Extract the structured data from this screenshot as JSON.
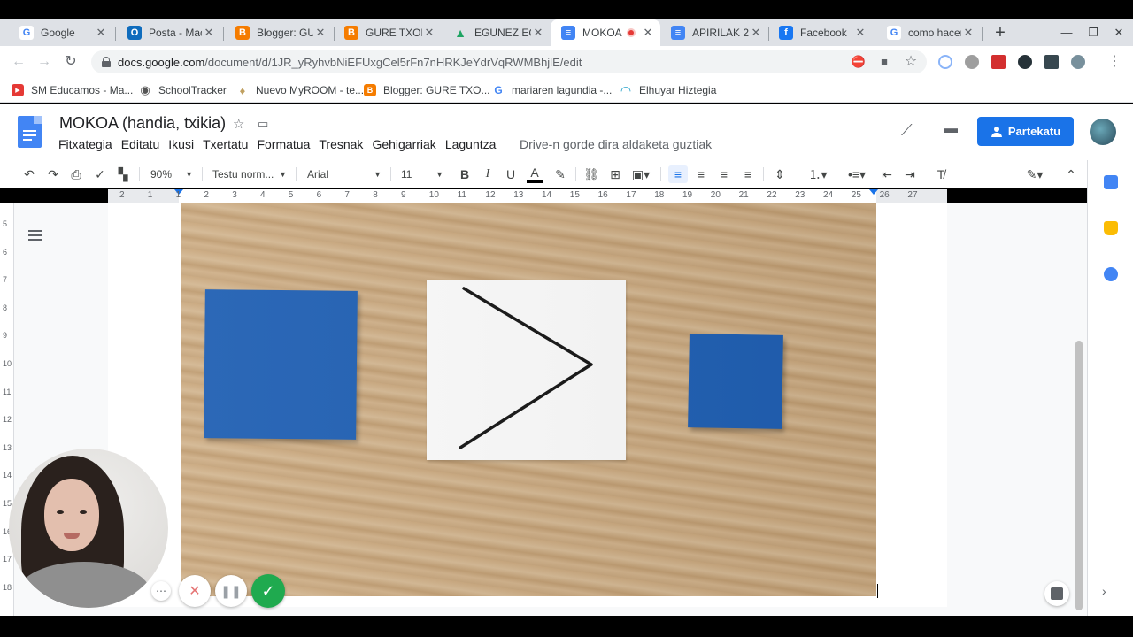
{
  "tabs": [
    {
      "title": "Google",
      "icon": "G",
      "color": "#4285f4"
    },
    {
      "title": "Posta - Mac",
      "icon": "O",
      "color": "#0f6cbd"
    },
    {
      "title": "Blogger: GU",
      "icon": "B",
      "color": "#f57c00"
    },
    {
      "title": "GURE TXOK",
      "icon": "B",
      "color": "#f57c00"
    },
    {
      "title": "EGUNEZ EG",
      "icon": "▲",
      "color": "#1fa463"
    },
    {
      "title": "MOKOA",
      "icon": "≡",
      "color": "#4285f4"
    },
    {
      "title": "APIRILAK 2",
      "icon": "≡",
      "color": "#4285f4"
    },
    {
      "title": "Facebook",
      "icon": "f",
      "color": "#1877f2"
    },
    {
      "title": "como hacer",
      "icon": "G",
      "color": "#4285f4"
    }
  ],
  "active_tab": 5,
  "close_glyph": "✕",
  "newtab_glyph": "+",
  "window": {
    "minimize": "—",
    "restore": "❐",
    "close": "✕"
  },
  "nav": {
    "back": "←",
    "forward": "→",
    "reload": "↻"
  },
  "url": {
    "host": "docs.google.com",
    "path": "/document/d/1JR_yRyhvbNiEFUxgCel5rFn7nHRKJeYdrVqRWMBhjlE/edit"
  },
  "bookmarks": [
    {
      "label": "SM Educamos - Ma...",
      "icon": "▶",
      "color": "#e53935"
    },
    {
      "label": "SchoolTracker",
      "icon": "◉",
      "color": "#555555"
    },
    {
      "label": "Nuevo MyROOM - te...",
      "icon": "♦",
      "color": "#c0a060"
    },
    {
      "label": "Blogger: GURE TXO...",
      "icon": "B",
      "color": "#f57c00"
    },
    {
      "label": "mariaren lagundia -...",
      "icon": "G",
      "color": "#4285f4"
    },
    {
      "label": "Elhuyar Hiztegia",
      "icon": "◠",
      "color": "#1fa0c8"
    }
  ],
  "document": {
    "title": "MOKOA (handia, txikia)",
    "saved_status": "Drive-n gorde dira aldaketa guztiak",
    "share_label": "Partekatu"
  },
  "menus": [
    "Fitxategia",
    "Editatu",
    "Ikusi",
    "Txertatu",
    "Formatua",
    "Tresnak",
    "Gehigarriak",
    "Laguntza"
  ],
  "format": {
    "zoom": "90%",
    "style": "Testu norm...",
    "font": "Arial",
    "size": "11"
  },
  "ruler_numbers": [
    "2",
    "1",
    "1",
    "2",
    "3",
    "4",
    "5",
    "6",
    "7",
    "8",
    "9",
    "10",
    "11",
    "12",
    "13",
    "14",
    "15",
    "16",
    "17",
    "18",
    "19",
    "20",
    "21",
    "22",
    "23",
    "24",
    "25",
    "26",
    "27"
  ],
  "vruler_numbers": [
    "5",
    "6",
    "7",
    "8",
    "9",
    "10",
    "11",
    "12",
    "13",
    "14",
    "15",
    "16",
    "17",
    "18"
  ],
  "colors": {
    "accent": "#1a73e8",
    "shape_blue": "#1f5fb3",
    "record_green": "#1faa4f"
  }
}
